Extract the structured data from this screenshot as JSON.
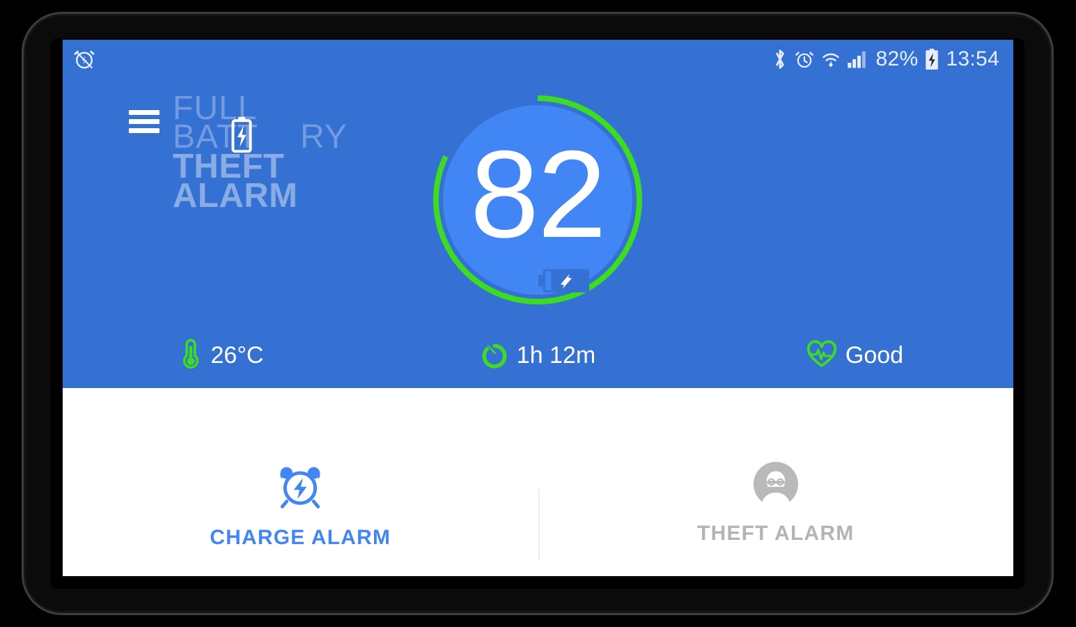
{
  "statusbar": {
    "icons_left": [
      "alarm-clock-icon"
    ],
    "icons_right": [
      "bluetooth-icon",
      "alarm-clock-icon",
      "wifi-icon",
      "signal-icon",
      "battery-charging-icon"
    ],
    "battery_percent": "82%",
    "time": "13:54"
  },
  "nav": {
    "menu_icon": "hamburger-menu-icon"
  },
  "logo": {
    "line1": "FULL",
    "line2_a": "BATT",
    "line2_b": "RY",
    "line2_icon": "battery-charging-icon",
    "line3": "THEFT",
    "line4": "ALARM"
  },
  "gauge": {
    "value": "82",
    "percent": 82,
    "center_icon": "battery-charging-horizontal-icon",
    "track_color": "#3570d3",
    "progress_color": "#3ddc23",
    "inner_color": "#4285f4"
  },
  "stats": [
    {
      "icon": "thermometer-icon",
      "label": "26°C"
    },
    {
      "icon": "stopwatch-icon",
      "label": "1h 12m"
    },
    {
      "icon": "heart-pulse-icon",
      "label": "Good"
    }
  ],
  "actions": [
    {
      "icon": "alarm-clock-bolt-icon",
      "label": "CHARGE ALARM",
      "color": "#4285f4",
      "state": "active"
    },
    {
      "icon": "thief-avatar-icon",
      "label": "THEFT ALARM",
      "color": "#b4b4b4",
      "state": "inactive"
    }
  ],
  "theme": {
    "header_blue": "#3570d3",
    "accent_blue": "#4285f4",
    "accent_green": "#3ddc23",
    "panel_white": "#ffffff",
    "muted_gray": "#b4b4b4"
  }
}
